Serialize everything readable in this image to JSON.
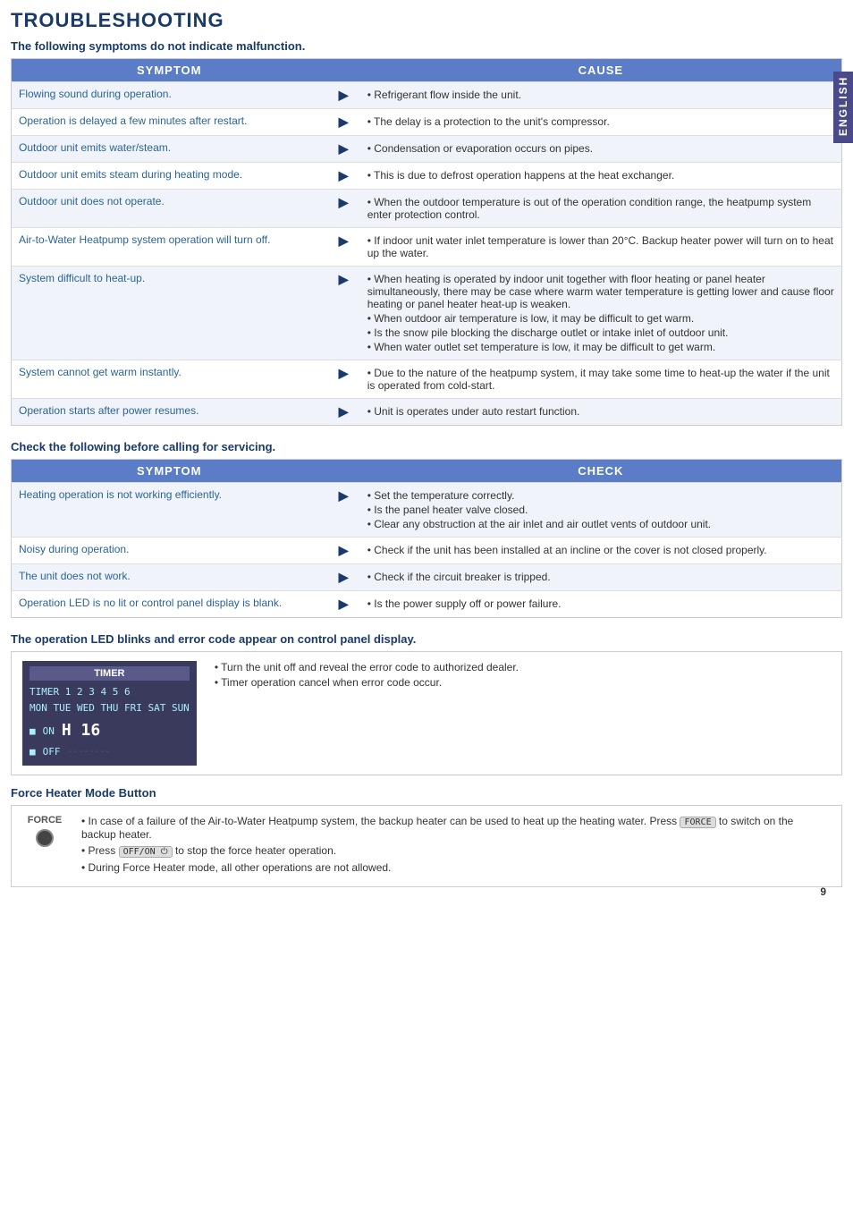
{
  "page": {
    "title": "TROUBLESHOOTING",
    "english_tab": "ENGLISH",
    "page_number": "9"
  },
  "section1": {
    "heading": "The following symptoms do not indicate malfunction.",
    "symptom_header": "SYMPTOM",
    "cause_header": "CAUSE",
    "rows": [
      {
        "symptom": "Flowing sound during operation.",
        "cause": [
          "Refrigerant flow inside the unit."
        ]
      },
      {
        "symptom": "Operation is delayed a few minutes after restart.",
        "cause": [
          "The delay is a protection to the unit's compressor."
        ]
      },
      {
        "symptom": "Outdoor unit emits water/steam.",
        "cause": [
          "Condensation or evaporation occurs on pipes."
        ]
      },
      {
        "symptom": "Outdoor unit emits steam during heating mode.",
        "cause": [
          "This is due to defrost operation happens at the heat exchanger."
        ]
      },
      {
        "symptom": "Outdoor unit does not operate.",
        "cause": [
          "When the outdoor temperature is out of the operation condition range, the heatpump system enter protection control."
        ]
      },
      {
        "symptom": "Air-to-Water Heatpump system operation will turn off.",
        "cause": [
          "If indoor unit water inlet temperature is lower than 20°C. Backup heater power will turn on to heat up the water."
        ]
      },
      {
        "symptom": "System difficult to heat-up.",
        "cause": [
          "When heating is operated by indoor unit together with floor heating or panel heater simultaneously, there may be case where warm water temperature is getting lower and cause floor heating or panel heater heat-up is weaken.",
          "When outdoor air temperature is low, it may be difficult to get warm.",
          "Is the snow pile blocking the discharge outlet or intake inlet of outdoor unit.",
          "When water outlet set temperature is low, it may be difficult to get warm."
        ]
      },
      {
        "symptom": "System cannot get warm instantly.",
        "cause": [
          "Due to the nature of the heatpump system, it may take some time to heat-up the water if the unit is operated from cold-start."
        ]
      },
      {
        "symptom": "Operation starts after power resumes.",
        "cause": [
          "Unit is operates under auto restart function."
        ]
      }
    ]
  },
  "section2": {
    "heading": "Check the following before calling for servicing.",
    "symptom_header": "SYMPTOM",
    "check_header": "CHECK",
    "rows": [
      {
        "symptom": "Heating operation is not working efficiently.",
        "check": [
          "Set the temperature correctly.",
          "Is the panel heater valve closed.",
          "Clear any obstruction at the air inlet and air outlet vents of outdoor unit."
        ]
      },
      {
        "symptom": "Noisy during operation.",
        "check": [
          "Check if the unit has been installed at an incline or the cover is not closed properly."
        ]
      },
      {
        "symptom": "The unit does not work.",
        "check": [
          "Check if the circuit breaker is tripped."
        ]
      },
      {
        "symptom": "Operation LED is no lit or control panel display is blank.",
        "check": [
          "Is the power supply off or power failure."
        ]
      }
    ]
  },
  "section3": {
    "heading": "The operation LED blinks and error code appear on control panel display.",
    "timer_title": "TIMER",
    "timer_display_line1": "TIMER 1 2 3 4 5 6",
    "timer_display_line2": "MON TUE WED THU FRI SAT SUN",
    "timer_on": "ON",
    "timer_off": "OFF",
    "timer_time": "H 16",
    "instructions": [
      "Turn the unit off and reveal the error code to authorized dealer.",
      "Timer operation cancel when error code occur."
    ]
  },
  "section4": {
    "heading": "Force Heater Mode Button",
    "force_label": "FORCE",
    "instructions": [
      "In case of a failure of the Air-to-Water Heatpump system, the backup heater can be used to heat up the heating water. Press FORCE to switch on the backup heater.",
      "Press OFF/ON to stop the force heater operation.",
      "During Force Heater mode, all other operations are not allowed."
    ]
  }
}
